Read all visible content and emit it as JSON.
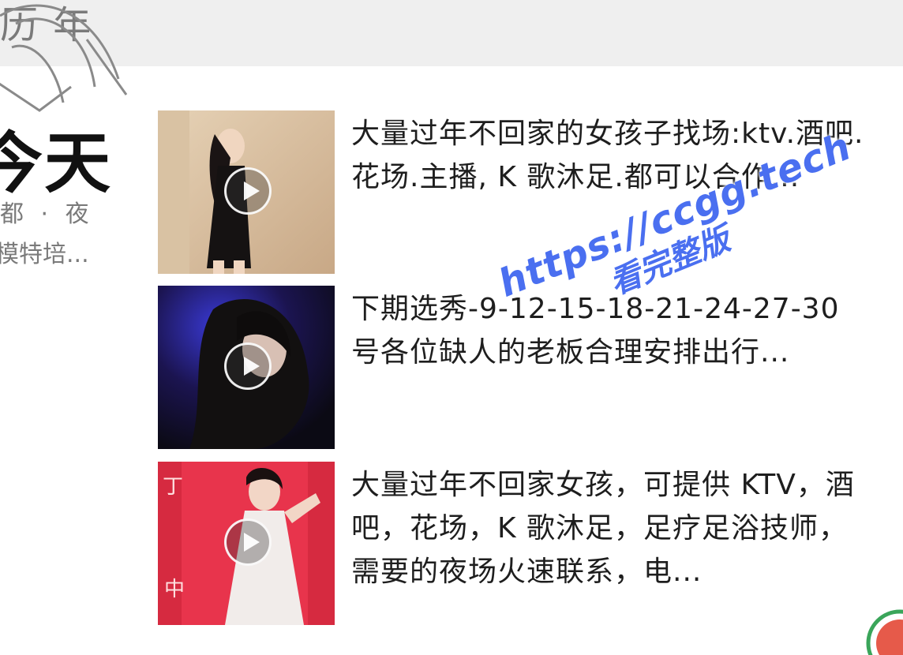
{
  "header": {
    "partial_text": "历 年"
  },
  "left_panel": {
    "title_partial": "今天",
    "sub1": "都 · 夜",
    "sub2": "模特培..."
  },
  "items": [
    {
      "description": "大量过年不回家的女孩子找场:ktv.酒吧.花场.主播, K 歌沐足.都可以合作..."
    },
    {
      "description": "下期选秀-9-12-15-18-21-24-27-30 号各位缺人的老板合理安排出行..."
    },
    {
      "description": "大量过年不回家女孩，可提供 KTV，酒吧，花场，K 歌沐足，足疗足浴技师，需要的夜场火速联系，电..."
    }
  ],
  "watermark": {
    "url": "https://ccgg.tech",
    "sub": "看完整版"
  },
  "colors": {
    "watermark": "#4a6ff0",
    "topbar": "#efefef"
  }
}
